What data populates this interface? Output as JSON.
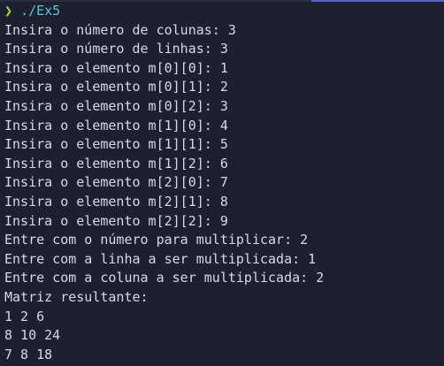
{
  "terminal": {
    "prompt_symbol": "❯",
    "command": "./Ex5",
    "output_lines": [
      "Insira o número de colunas: 3",
      "Insira o número de linhas: 3",
      "Insira o elemento m[0][0]: 1",
      "Insira o elemento m[0][1]: 2",
      "Insira o elemento m[0][2]: 3",
      "Insira o elemento m[1][0]: 4",
      "Insira o elemento m[1][1]: 5",
      "Insira o elemento m[1][2]: 6",
      "Insira o elemento m[2][0]: 7",
      "Insira o elemento m[2][1]: 8",
      "Insira o elemento m[2][2]: 9",
      "Entre com o número para multiplicar: 2",
      "Entre com a linha a ser multiplicada: 1",
      "Entre com a coluna a ser multiplicada: 2",
      "Matriz resultante:",
      "1 2 6",
      "8 10 24",
      "7 8 18"
    ]
  },
  "colors": {
    "background": "#1e2030",
    "text": "#d6d9e6",
    "prompt_arrow": "#a6e22e",
    "command": "#57c7d4"
  }
}
